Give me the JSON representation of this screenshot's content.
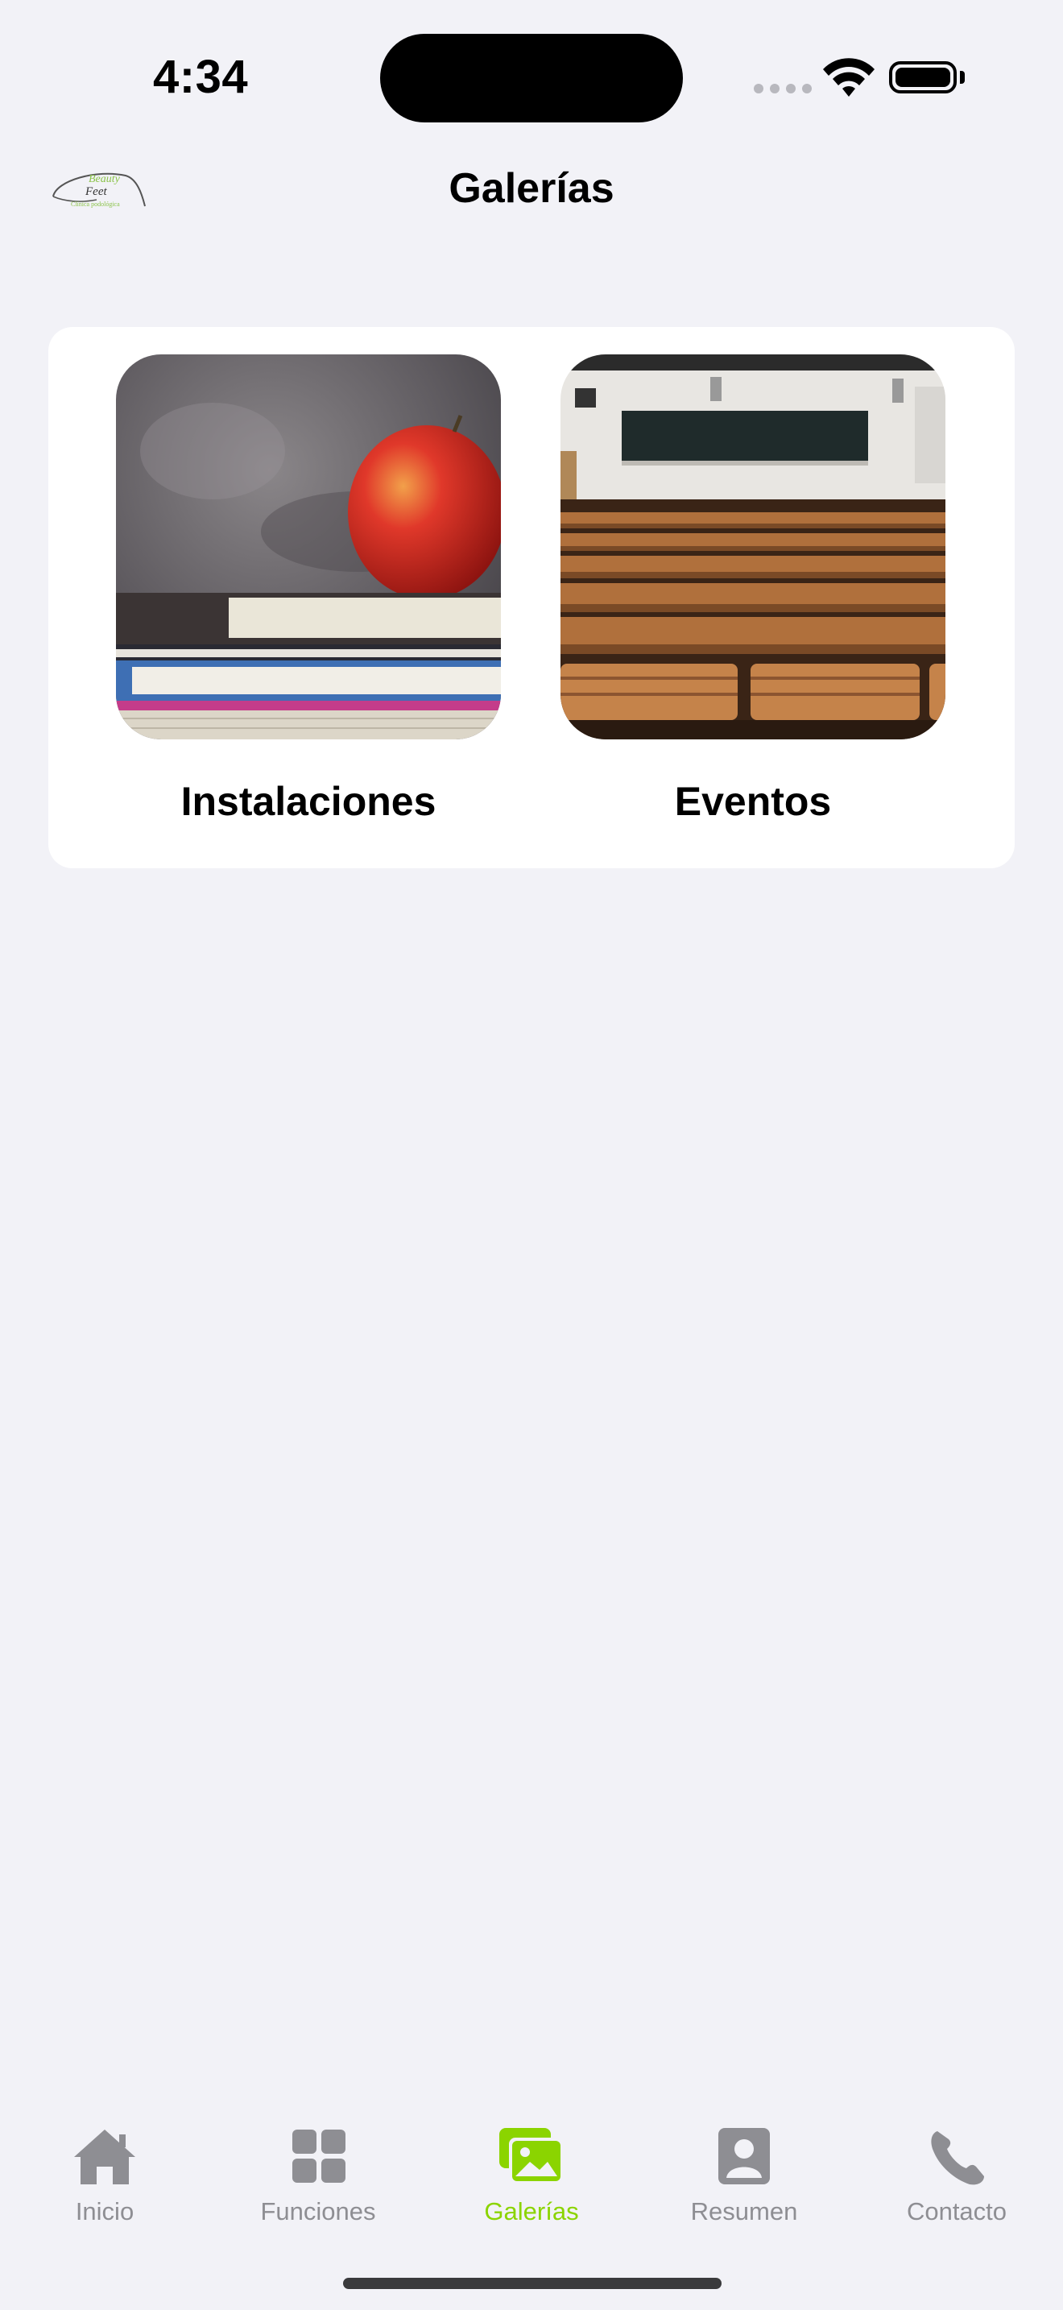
{
  "status_bar": {
    "time": "4:34"
  },
  "nav": {
    "title": "Galerías",
    "logo_text": {
      "line1": "Beauty",
      "line2": "Feet",
      "line3": "Clínica podológica"
    }
  },
  "gallery": {
    "items": [
      {
        "label": "Instalaciones",
        "image": "apple-on-books-photo"
      },
      {
        "label": "Eventos",
        "image": "lecture-hall-seats-photo"
      }
    ]
  },
  "tabbar": {
    "active_color": "#8bd400",
    "inactive_color": "#8e8e93",
    "tabs": [
      {
        "label": "Inicio",
        "icon": "house-icon",
        "active": false
      },
      {
        "label": "Funciones",
        "icon": "grid-icon",
        "active": false
      },
      {
        "label": "Galerías",
        "icon": "photos-icon",
        "active": true
      },
      {
        "label": "Resumen",
        "icon": "person-card-icon",
        "active": false
      },
      {
        "label": "Contacto",
        "icon": "phone-icon",
        "active": false
      }
    ]
  }
}
